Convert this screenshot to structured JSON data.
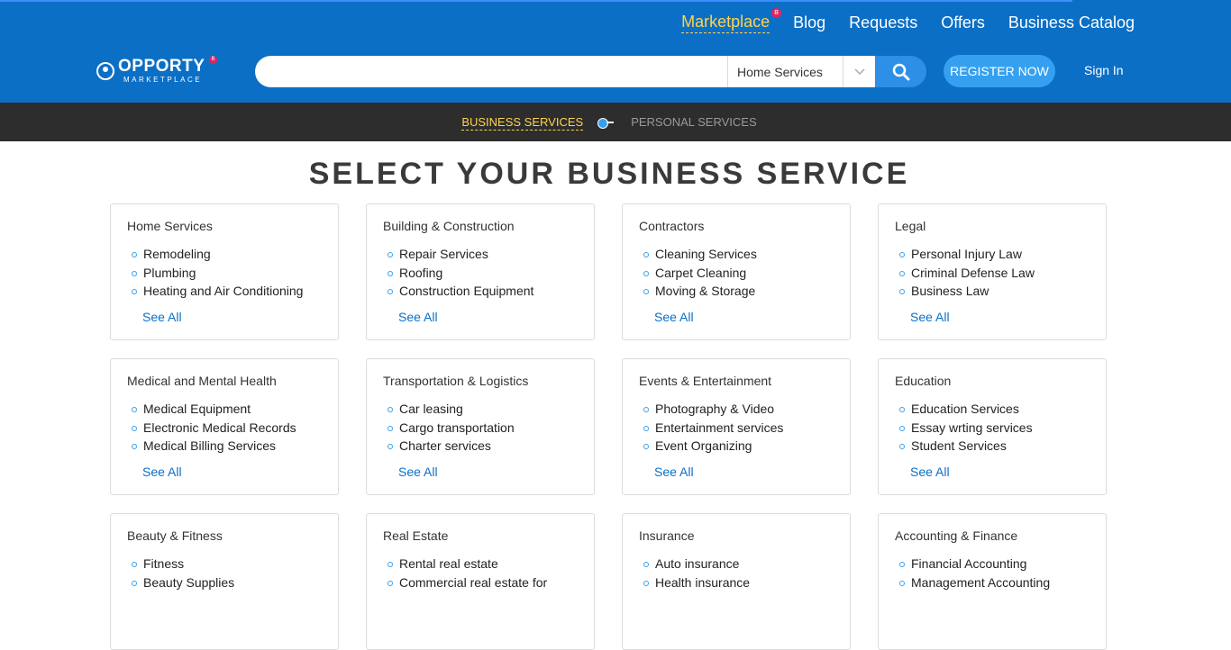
{
  "nav": {
    "items": [
      {
        "label": "Marketplace",
        "active": true,
        "badge": "B"
      },
      {
        "label": "Blog"
      },
      {
        "label": "Requests"
      },
      {
        "label": "Offers"
      },
      {
        "label": "Business Catalog"
      }
    ]
  },
  "logo": {
    "name": "OPPORTY",
    "sub": "MARKETPLACE",
    "badge": "B"
  },
  "search": {
    "placeholder": "",
    "category": "Home Services"
  },
  "header": {
    "register": "REGISTER NOW",
    "signin": "Sign In"
  },
  "modes": {
    "business": "BUSINESS SERVICES",
    "personal": "PERSONAL SERVICES"
  },
  "page": {
    "title": "SELECT YOUR BUSINESS SERVICE"
  },
  "colors": {
    "brand": "#0b6fc6",
    "accent": "#ffd34d",
    "dark_bar": "#2d2d2d"
  },
  "categories": [
    {
      "title": "Home Services",
      "items": [
        "Remodeling",
        "Plumbing",
        "Heating and Air Conditioning"
      ],
      "see_all": "See All"
    },
    {
      "title": "Building & Construction",
      "items": [
        "Repair Services",
        "Roofing",
        "Construction Equipment"
      ],
      "see_all": "See All"
    },
    {
      "title": "Contractors",
      "items": [
        "Cleaning Services",
        "Carpet Cleaning",
        "Moving & Storage"
      ],
      "see_all": "See All"
    },
    {
      "title": "Legal",
      "items": [
        "Personal Injury Law",
        "Criminal Defense Law",
        "Business Law"
      ],
      "see_all": "See All"
    },
    {
      "title": "Medical and Mental Health",
      "items": [
        "Medical Equipment",
        "Electronic Medical Records",
        "Medical Billing Services"
      ],
      "see_all": "See All"
    },
    {
      "title": "Transportation & Logistics",
      "items": [
        "Car leasing",
        "Cargo transportation",
        "Charter services"
      ],
      "see_all": "See All"
    },
    {
      "title": "Events & Entertainment",
      "items": [
        "Photography & Video",
        "Entertainment services",
        "Event Organizing"
      ],
      "see_all": "See All"
    },
    {
      "title": "Education",
      "items": [
        "Education Services",
        "Essay wrting services",
        "Student Services"
      ],
      "see_all": "See All"
    },
    {
      "title": "Beauty & Fitness",
      "items": [
        "Fitness",
        "Beauty Supplies"
      ],
      "see_all": ""
    },
    {
      "title": "Real Estate",
      "items": [
        "Rental real estate",
        "Commercial real estate for"
      ],
      "see_all": ""
    },
    {
      "title": "Insurance",
      "items": [
        "Auto insurance",
        "Health insurance"
      ],
      "see_all": ""
    },
    {
      "title": "Accounting & Finance",
      "items": [
        "Financial Accounting",
        "Management Accounting"
      ],
      "see_all": ""
    }
  ]
}
